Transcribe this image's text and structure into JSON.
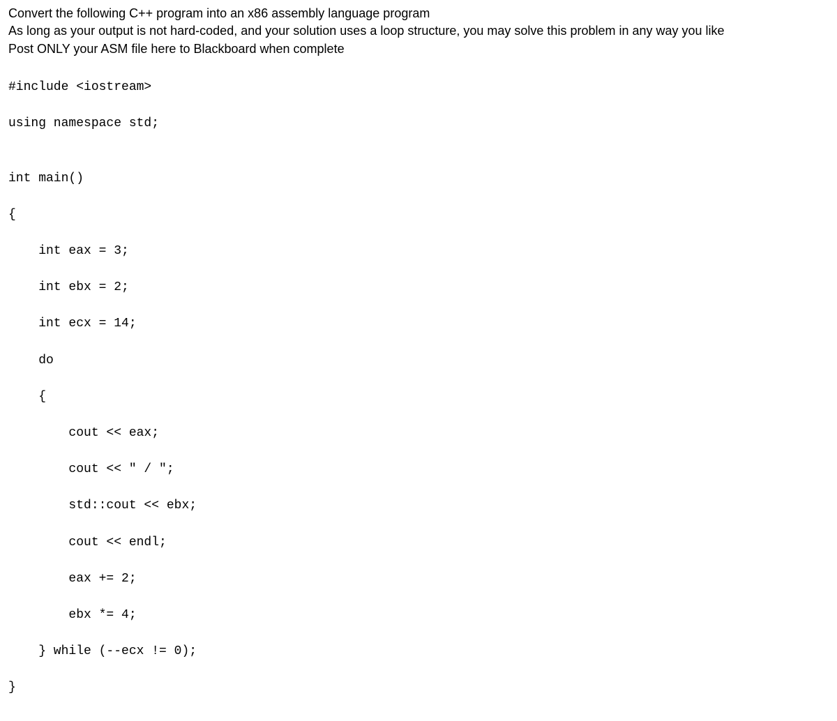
{
  "instructions": {
    "line1": "Convert the following C++ program into an x86 assembly language program",
    "line2": "As long as your output is not hard-coded, and your solution uses a loop structure, you may solve this problem in any way you like",
    "line3": "Post ONLY your ASM file here to Blackboard when complete"
  },
  "code": {
    "l01": "#include <iostream>",
    "l02": "using namespace std;",
    "l03": "",
    "l04": "int main()",
    "l05": "{",
    "l06": "    int eax = 3;",
    "l07": "    int ebx = 2;",
    "l08": "    int ecx = 14;",
    "l09": "    do",
    "l10": "    {",
    "l11": "        cout << eax;",
    "l12": "        cout << \" / \";",
    "l13": "        std::cout << ebx;",
    "l14": "        cout << endl;",
    "l15": "        eax += 2;",
    "l16": "        ebx *= 4;",
    "l17": "    } while (--ecx != 0);",
    "l18": "}"
  }
}
